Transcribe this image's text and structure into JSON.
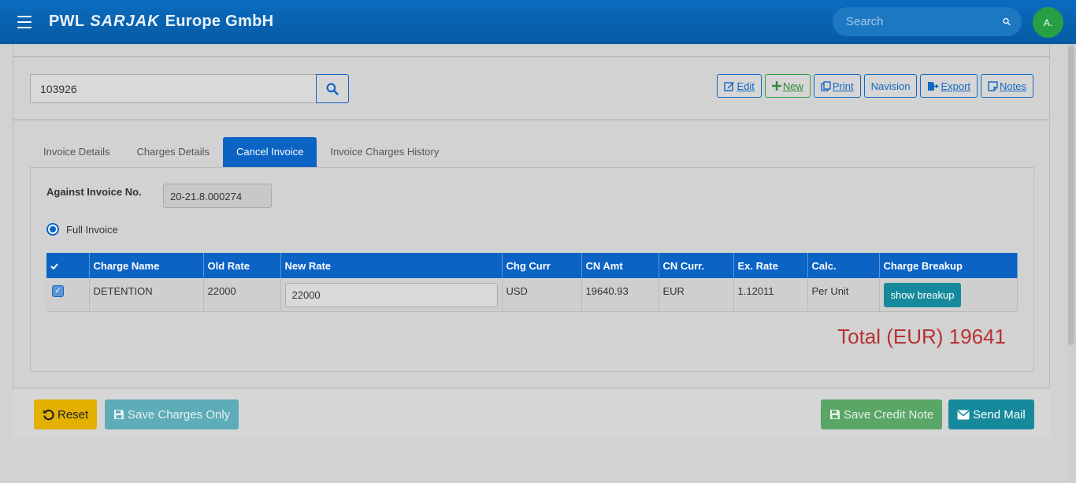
{
  "header": {
    "brand_prefix": "PWL",
    "brand_logo": "SARJAK",
    "brand_suffix": "Europe GmbH",
    "search_placeholder": "Search",
    "avatar_text": "A."
  },
  "search_bar": {
    "invoice_value": "103926"
  },
  "toolbar": {
    "edit": "Edit",
    "new": "New",
    "print": "Print",
    "navision": "Navision",
    "export": "Export",
    "notes": "Notes"
  },
  "tabs": [
    {
      "label": "Invoice Details",
      "active": false
    },
    {
      "label": "Charges Details",
      "active": false
    },
    {
      "label": "Cancel Invoice",
      "active": true
    },
    {
      "label": "Invoice Charges History",
      "active": false
    }
  ],
  "cancel_invoice": {
    "against_label": "Against Invoice No.",
    "against_value": "20-21.8.000274",
    "radio_label": "Full Invoice",
    "columns": [
      "Charge Name",
      "Old Rate",
      "New Rate",
      "Chg Curr",
      "CN Amt",
      "CN Curr.",
      "Ex. Rate",
      "Calc.",
      "Charge Breakup"
    ],
    "rows": [
      {
        "charge_name": "DETENTION",
        "old_rate": "22000",
        "new_rate": "22000",
        "chg_curr": "USD",
        "cn_amt": "19640.93",
        "cn_curr": "EUR",
        "ex_rate": "1.12011",
        "calc": "Per Unit",
        "breakup_label": "show breakup"
      }
    ],
    "total_text": "Total (EUR) 19641"
  },
  "footer": {
    "reset": "Reset",
    "save_charges": "Save Charges Only",
    "save_credit": "Save Credit Note",
    "send_mail": "Send Mail"
  },
  "colors": {
    "primary": "#0b63c4",
    "header": "#0a6cbf",
    "total": "#b83232",
    "reset": "#e3b000",
    "teal": "#168a9c",
    "green": "#5aa667"
  }
}
